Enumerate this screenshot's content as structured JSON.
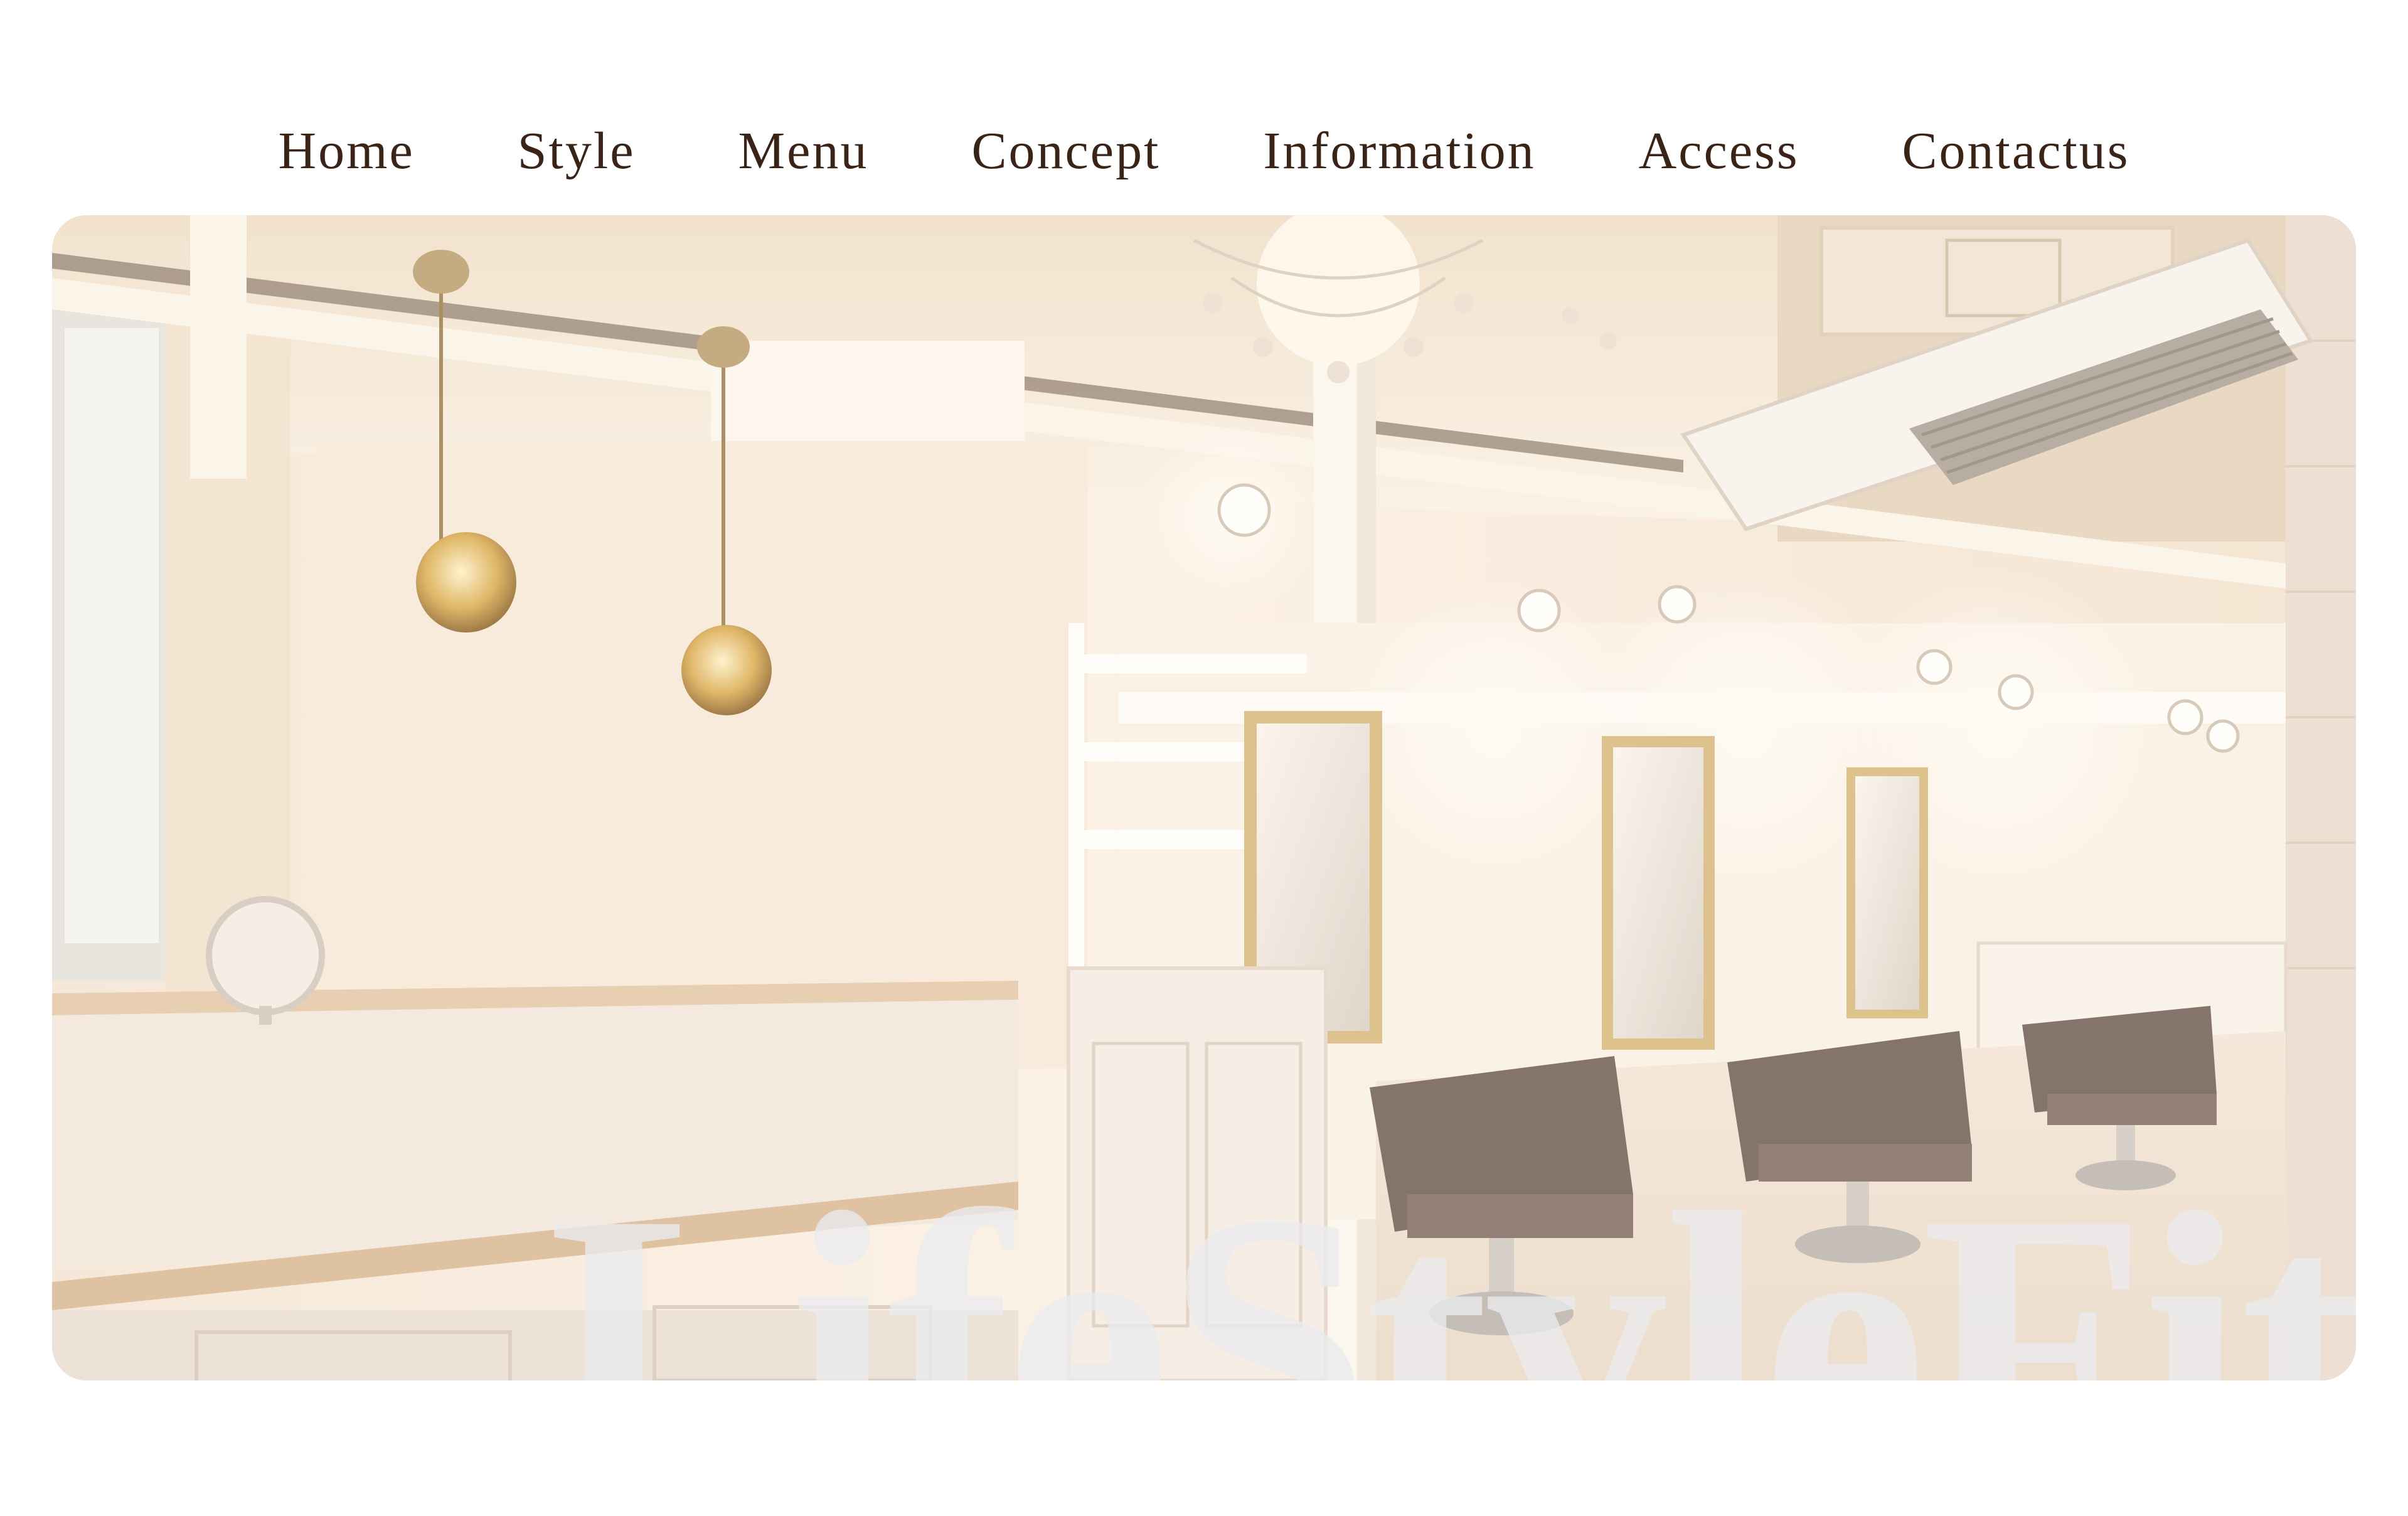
{
  "nav": {
    "items": [
      {
        "label": "Home"
      },
      {
        "label": "Style"
      },
      {
        "label": "Menu"
      },
      {
        "label": "Concept"
      },
      {
        "label": "Information"
      },
      {
        "label": "Access"
      },
      {
        "label": "Contactus"
      }
    ]
  },
  "hero": {
    "title": "LifeStyleFit"
  },
  "colors": {
    "nav_text": "#3a2418",
    "hero_title": "#ebebee",
    "wall": "#f7ece0",
    "chair": "#6b5852",
    "mirror_frame": "#d7b77c"
  }
}
